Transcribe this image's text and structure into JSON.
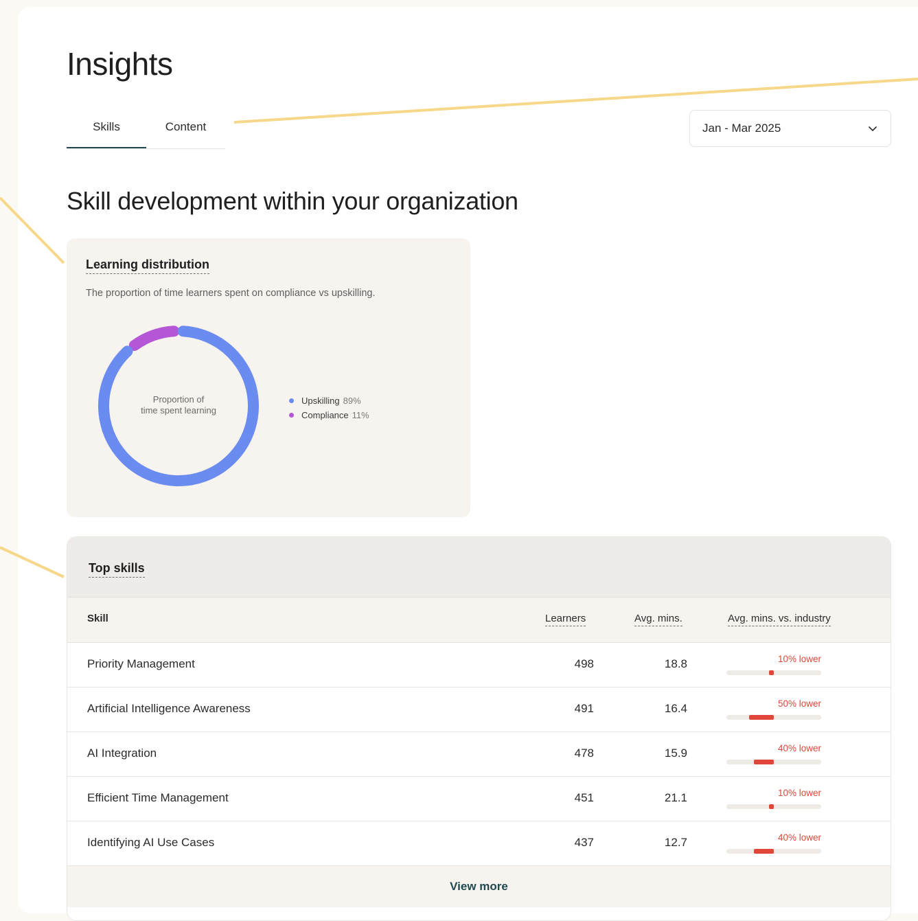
{
  "page": {
    "title": "Insights"
  },
  "tabs": [
    {
      "label": "Skills"
    },
    {
      "label": "Content"
    }
  ],
  "date_filter": {
    "value": "Jan - Mar 2025",
    "icon": "chevron-down-icon"
  },
  "section": {
    "title": "Skill development within your organization"
  },
  "learning_distribution": {
    "title": "Learning distribution",
    "description": "The proportion of time learners spent on compliance vs upskilling.",
    "center_label_line1": "Proportion of",
    "center_label_line2": "time spent learning",
    "legend": [
      {
        "name": "Upskilling",
        "value": "89%",
        "color": "#6a8bef"
      },
      {
        "name": "Compliance",
        "value": "11%",
        "color": "#b556d6"
      }
    ]
  },
  "chart_data": {
    "type": "pie",
    "categories": [
      "Upskilling",
      "Compliance"
    ],
    "values": [
      89,
      11
    ],
    "title": "",
    "colors": [
      "#6a8bef",
      "#b556d6"
    ]
  },
  "top_skills": {
    "title": "Top skills",
    "columns": {
      "skill": "Skill",
      "learners": "Learners",
      "avg_mins": "Avg. mins.",
      "vs_industry": "Avg. mins. vs. industry"
    },
    "rows": [
      {
        "skill": "Priority Management",
        "learners": "498",
        "avg_mins": "18.8",
        "vs_industry": "10% lower",
        "lower_pct": 10
      },
      {
        "skill": "Artificial Intelligence Awareness",
        "learners": "491",
        "avg_mins": "16.4",
        "vs_industry": "50% lower",
        "lower_pct": 50
      },
      {
        "skill": "AI Integration",
        "learners": "478",
        "avg_mins": "15.9",
        "vs_industry": "40% lower",
        "lower_pct": 40
      },
      {
        "skill": "Efficient Time Management",
        "learners": "451",
        "avg_mins": "21.1",
        "vs_industry": "10% lower",
        "lower_pct": 10
      },
      {
        "skill": "Identifying AI Use Cases",
        "learners": "437",
        "avg_mins": "12.7",
        "vs_industry": "40% lower",
        "lower_pct": 40
      }
    ],
    "view_more": "View more"
  },
  "colors": {
    "accent": "#21494f",
    "negative": "#d9483a",
    "annotation_line": "#f7d88a"
  }
}
